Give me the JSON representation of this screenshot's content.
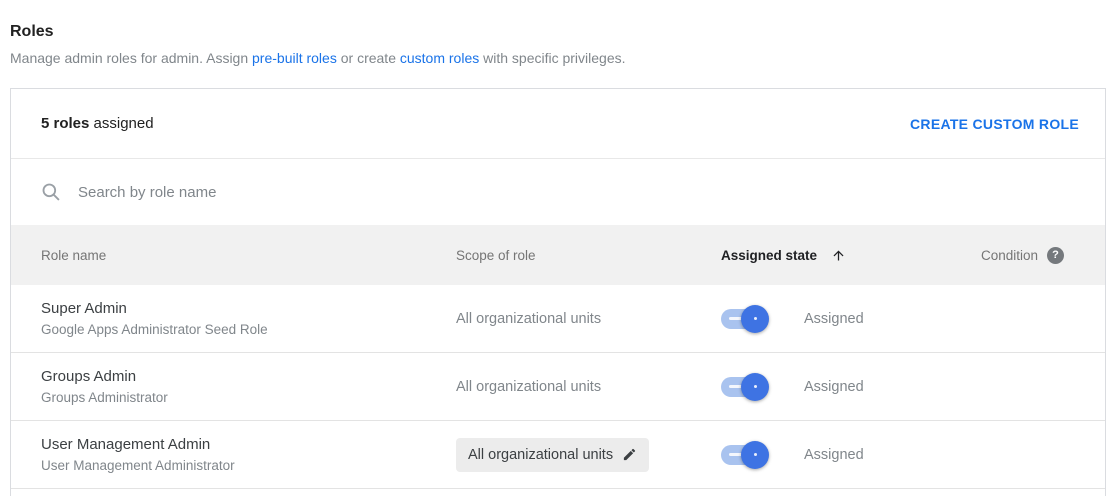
{
  "page": {
    "title": "Roles",
    "subtitle": {
      "part1": "Manage admin roles for admin. Assign ",
      "link_prebuilt": "pre-built roles",
      "part2": " or create ",
      "link_custom": "custom roles",
      "part3": " with specific privileges."
    }
  },
  "panel": {
    "count_bold": "5 roles",
    "count_rest": " assigned",
    "create_button": "CREATE CUSTOM ROLE",
    "search_placeholder": "Search by role name",
    "search_icon": "search-icon"
  },
  "table": {
    "headers": {
      "role_name": "Role name",
      "scope": "Scope of role",
      "assigned_state": "Assigned state",
      "sort_direction": "ascending",
      "sort_icon": "arrow-upward-icon",
      "condition": "Condition",
      "help_glyph": "?",
      "help_icon": "help-icon"
    },
    "rows": [
      {
        "name": "Super Admin",
        "description": "Google Apps Administrator Seed Role",
        "scope": "All organizational units",
        "scope_editable": false,
        "assigned": true,
        "state_label": "Assigned"
      },
      {
        "name": "Groups Admin",
        "description": "Groups Administrator",
        "scope": "All organizational units",
        "scope_editable": false,
        "assigned": true,
        "state_label": "Assigned"
      },
      {
        "name": "User Management Admin",
        "description": "User Management Administrator",
        "scope": "All organizational units",
        "scope_editable": true,
        "scope_edit_icon": "pencil-icon",
        "assigned": true,
        "state_label": "Assigned"
      }
    ]
  },
  "colors": {
    "link_blue": "#1a73e8",
    "toggle_track": "#a9c3ef",
    "toggle_thumb": "#3e73e3",
    "header_band": "#f1f1f1",
    "chip_bg": "#ececec",
    "text_primary": "#3c4043",
    "text_secondary": "#80868b"
  }
}
